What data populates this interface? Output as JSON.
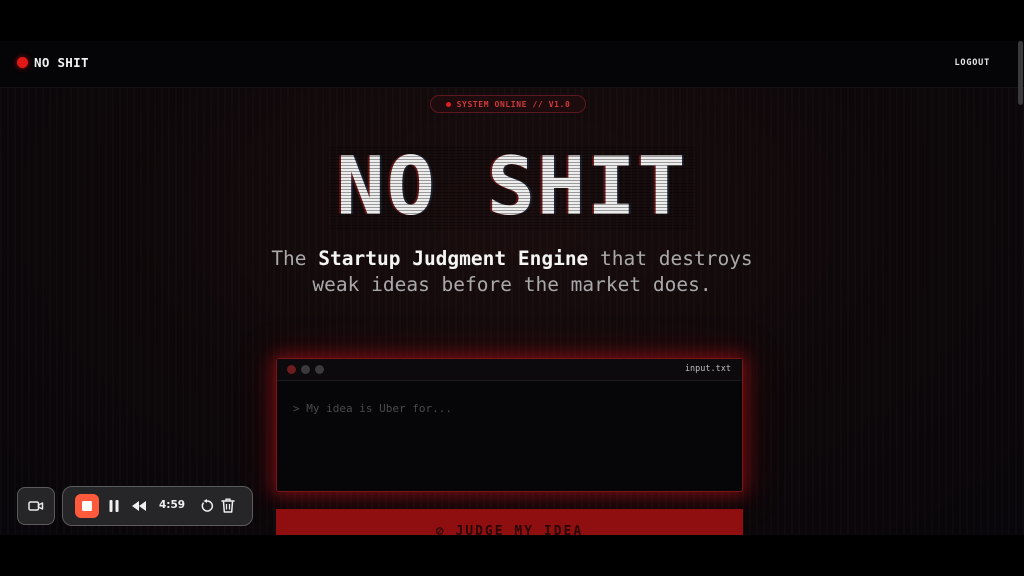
{
  "nav": {
    "brand": "NO SHIT",
    "logout": "LOGOUT"
  },
  "status": {
    "text": "SYSTEM ONLINE // V1.0"
  },
  "hero": {
    "title": "NO SHIT",
    "tagline_prefix": "The ",
    "tagline_bold": "Startup Judgment Engine",
    "tagline_suffix": " that destroys weak ideas before the market does."
  },
  "terminal": {
    "filename": "input.txt",
    "placeholder": "> My idea is Uber for..."
  },
  "cta": {
    "label": "⊘ JUDGE MY IDEA"
  },
  "recorder": {
    "time": "4:59",
    "icons": [
      "camera-icon",
      "stop-icon",
      "pause-icon",
      "rewind-icon",
      "restart-icon",
      "trash-icon"
    ]
  },
  "colors": {
    "accent": "#e01818",
    "cta_bg": "#8f0f11",
    "record_stop": "#ff5a3c"
  }
}
